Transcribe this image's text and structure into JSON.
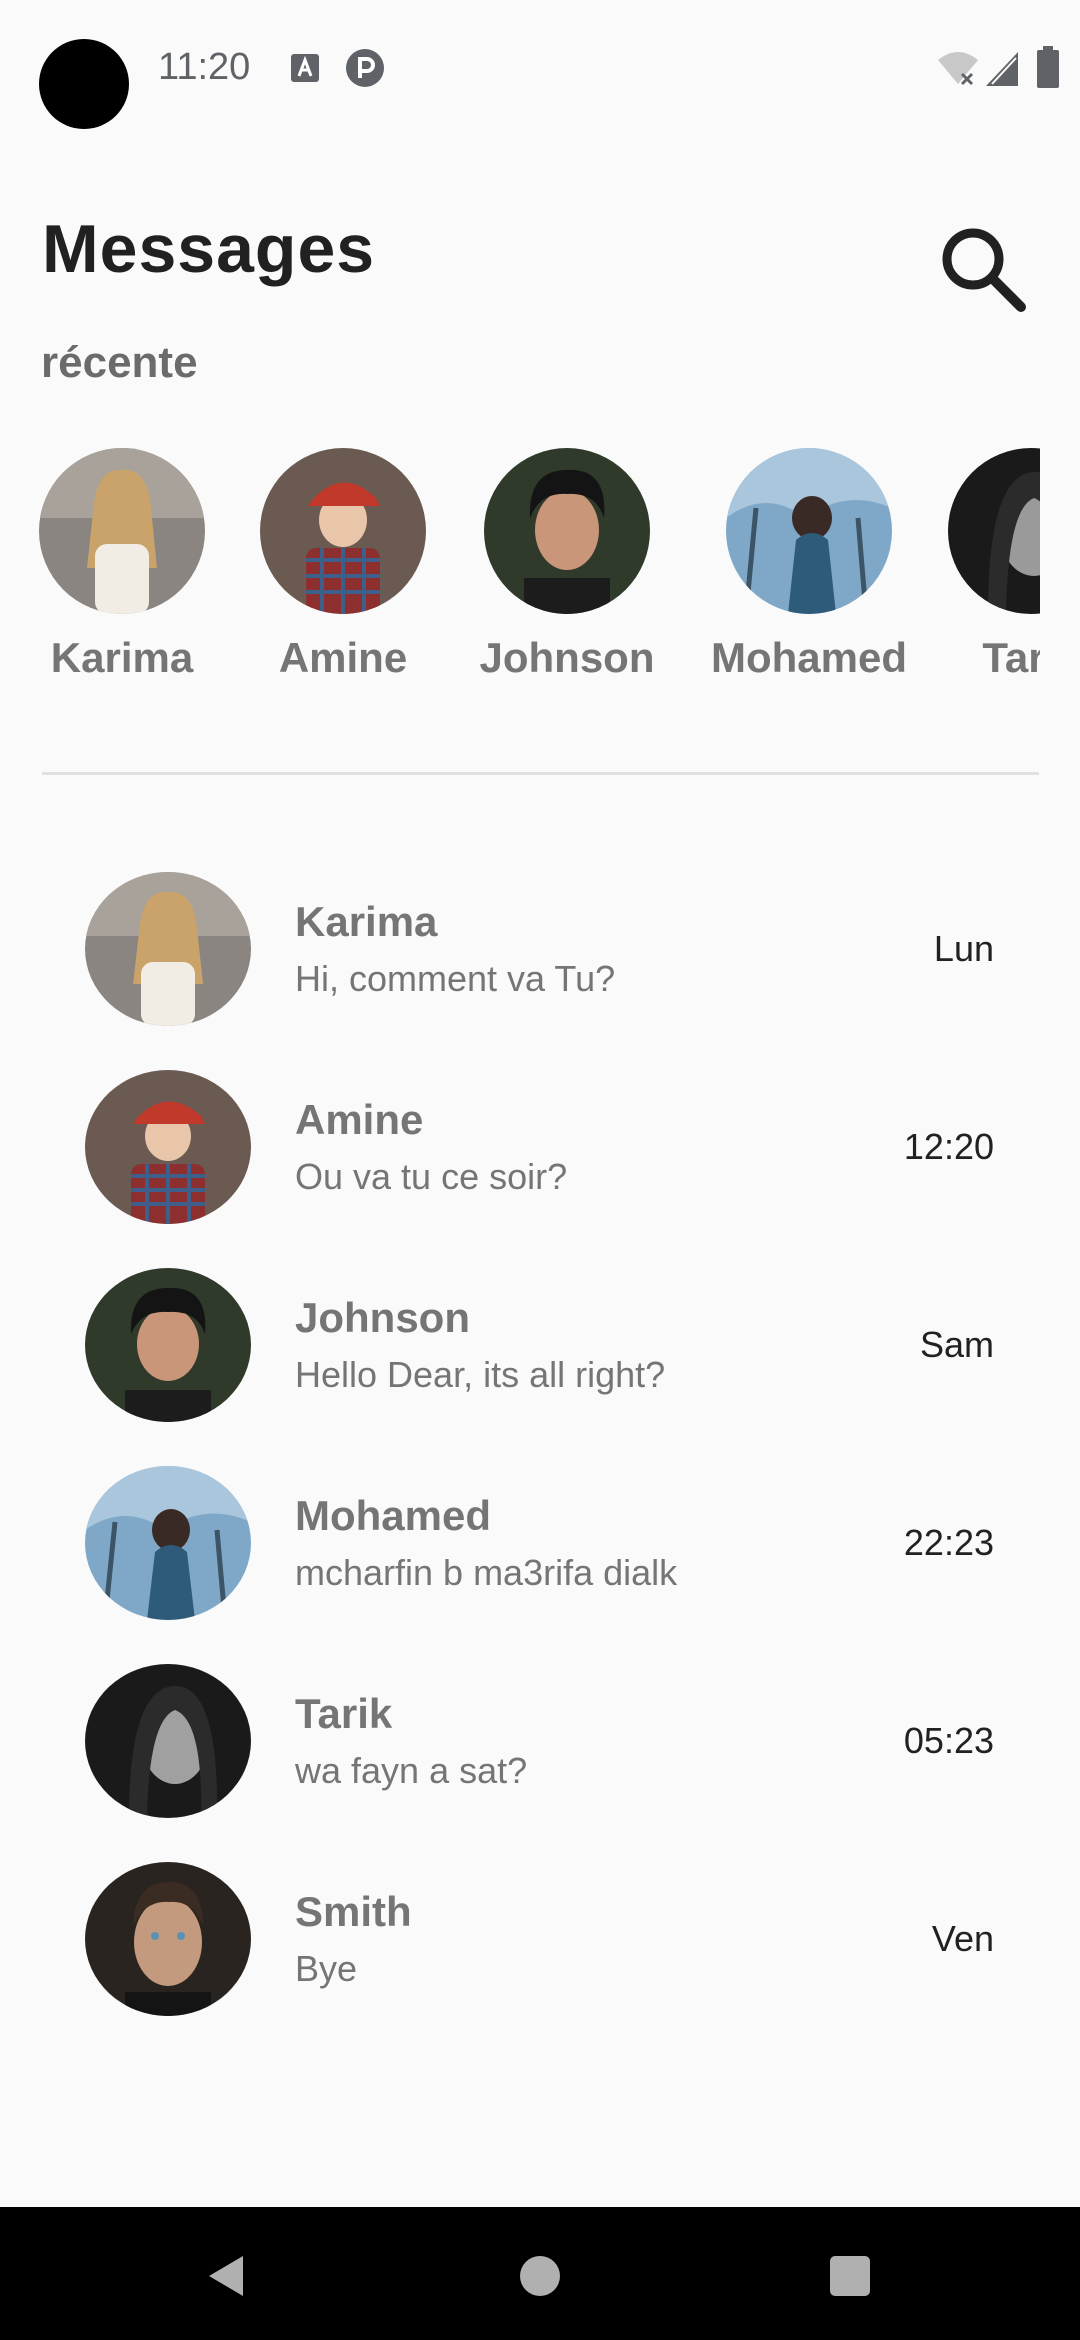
{
  "status_bar": {
    "time": "11:20",
    "icons": [
      "notification-a-icon",
      "notification-p-icon",
      "wifi-icon",
      "signal-icon",
      "battery-icon"
    ]
  },
  "header": {
    "title": "Messages",
    "search_icon": "search-icon"
  },
  "recent": {
    "label": "récente",
    "items": [
      {
        "name": "Karima",
        "avatar": "woman-blonde-photo"
      },
      {
        "name": "Amine",
        "avatar": "boy-red-cap-photo"
      },
      {
        "name": "Johnson",
        "avatar": "young-man-dark-hair-photo"
      },
      {
        "name": "Mohamed",
        "avatar": "woman-blue-forest-photo"
      },
      {
        "name": "Tarik",
        "avatar": "woman-black-white-photo"
      }
    ]
  },
  "conversations": [
    {
      "name": "Karima",
      "preview": "Hi, comment va Tu?",
      "time": "Lun"
    },
    {
      "name": "Amine",
      "preview": "Ou va tu ce soir?",
      "time": "12:20"
    },
    {
      "name": "Johnson",
      "preview": "Hello Dear, its all right?",
      "time": "Sam"
    },
    {
      "name": "Mohamed",
      "preview": "mcharfin b ma3rifa dialk",
      "time": "22:23"
    },
    {
      "name": "Tarik",
      "preview": "wa fayn a sat?",
      "time": "05:23"
    },
    {
      "name": "Smith",
      "preview": "Bye",
      "time": "Ven"
    }
  ],
  "nav_bar": {
    "buttons": [
      "back-icon",
      "home-icon",
      "recents-icon"
    ]
  },
  "colors": {
    "background": "#fafafa",
    "title": "#212121",
    "muted_text": "#757575",
    "divider": "#e0e0e0",
    "nav_bar": "#000000"
  }
}
